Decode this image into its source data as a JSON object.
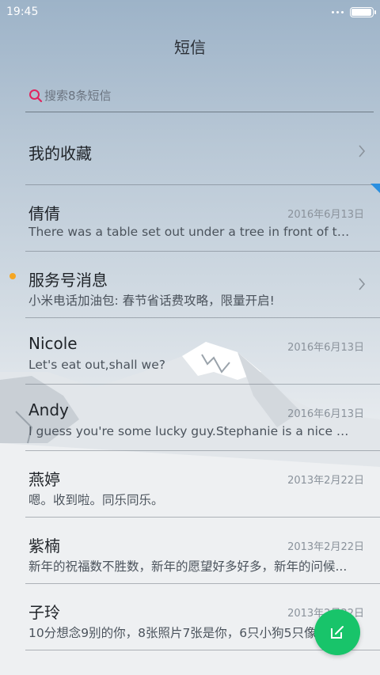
{
  "status": {
    "time": "19:45",
    "battery_level": 0.95
  },
  "header": {
    "title": "短信"
  },
  "search": {
    "placeholder": "搜索8条短信"
  },
  "favorites": {
    "label": "我的收藏"
  },
  "conversations": [
    {
      "name": "倩倩",
      "date": "2016年6月13日",
      "preview": "There was a table set out under a tree in front of the ho..."
    },
    {
      "name": "服务号消息",
      "date": "",
      "preview": "小米电话加油包: 春节省话费攻略，限量开启!",
      "unread": true
    },
    {
      "name": "Nicole",
      "date": "2016年6月13日",
      "preview": "Let's eat out,shall we?"
    },
    {
      "name": "Andy",
      "date": "2016年6月13日",
      "preview": "I guess you're some lucky guy.Stephanie is a nice girl."
    },
    {
      "name": "燕婷",
      "date": "2013年2月22日",
      "preview": "嗯。收到啦。同乐同乐。"
    },
    {
      "name": "紫楠",
      "date": "2013年2月22日",
      "preview": "新年的祝福数不胜数，新年的愿望好多好多，新年的问候..."
    },
    {
      "name": "子玲",
      "date": "2013年2月22日",
      "preview": "10分想念9别的你，8张照片7张是你，6只小狗5只像你..."
    }
  ],
  "colors": {
    "accent_search": "#e0245e",
    "fab": "#18c46a",
    "unread_dot": "#f5a623"
  },
  "icons": {
    "search": "search-icon",
    "chevron": "chevron-right-icon",
    "compose": "compose-icon"
  }
}
